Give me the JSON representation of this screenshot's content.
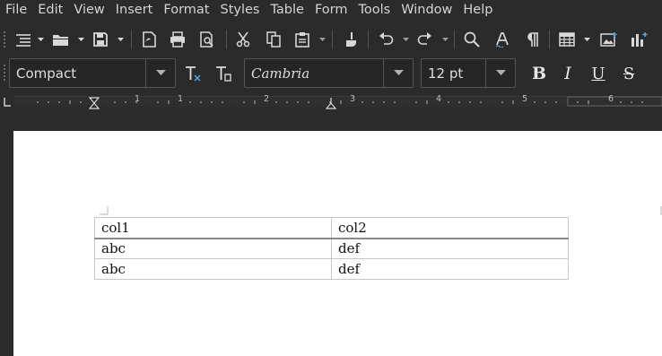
{
  "menubar": {
    "items": [
      "File",
      "Edit",
      "View",
      "Insert",
      "Format",
      "Styles",
      "Table",
      "Form",
      "Tools",
      "Window",
      "Help"
    ]
  },
  "toolbar": {
    "buttons": [
      "sidebar-toggle",
      "open",
      "save",
      "export-pdf",
      "print",
      "print-preview",
      "cut",
      "copy",
      "paste",
      "clone-formatting",
      "undo",
      "redo",
      "find-replace",
      "spelling",
      "formatting-marks",
      "insert-table",
      "insert-image",
      "insert-chart"
    ]
  },
  "formatting": {
    "paragraph_style": "Compact",
    "font_name": "Cambria",
    "font_size": "12 pt",
    "bold": "B",
    "italic": "I",
    "underline": "U",
    "strikethrough": "S"
  },
  "ruler": {
    "numbers": [
      "1",
      "1",
      "2",
      "3",
      "4",
      "5",
      "6"
    ]
  },
  "document": {
    "table": {
      "header": [
        "col1",
        "col2"
      ],
      "rows": [
        [
          "abc",
          "def"
        ],
        [
          "abc",
          "def"
        ]
      ]
    }
  },
  "colors": {
    "chrome_bg": "#2b2b2b",
    "page_bg": "#ffffff",
    "text": "#d4d4d4"
  }
}
